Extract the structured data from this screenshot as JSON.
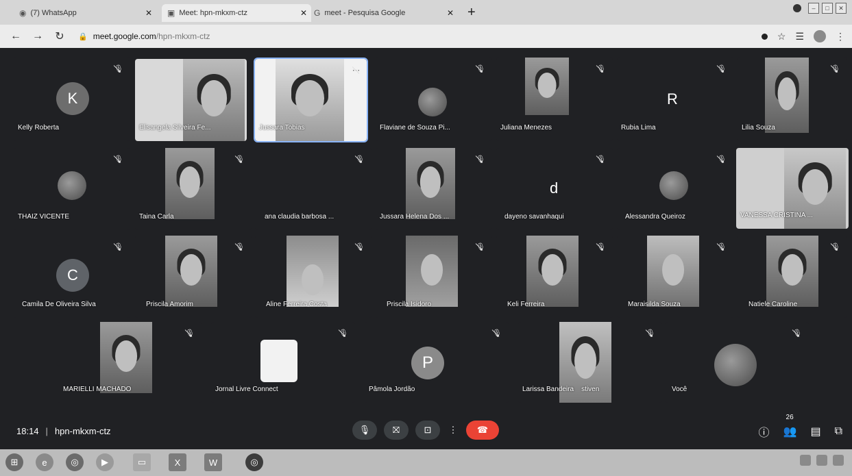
{
  "browser": {
    "tabs": [
      {
        "label": "(7) WhatsApp",
        "icon": "whatsapp-icon"
      },
      {
        "label": "Meet: hpn-mkxm-ctz",
        "icon": "meet-icon",
        "active": true
      },
      {
        "label": "meet - Pesquisa Google",
        "icon": "google-icon"
      }
    ],
    "url_host": "meet.google.com",
    "url_path": "/hpn-mkxm-ctz"
  },
  "meet": {
    "participants": [
      {
        "name": "Kelly Roberta",
        "avatar_letter": "K"
      },
      {
        "name": "Elisangela Silveira Fe...",
        "avatar_letter": ""
      },
      {
        "name": "Jussara Tobias",
        "avatar_letter": ""
      },
      {
        "name": "Flaviane de Souza Pi...",
        "avatar_letter": ""
      },
      {
        "name": "Juliana Menezes",
        "avatar_letter": ""
      },
      {
        "name": "Rubia Lima",
        "avatar_letter": "R"
      },
      {
        "name": "Lilia Souza",
        "avatar_letter": ""
      },
      {
        "name": "THAIZ VICENTE",
        "avatar_letter": ""
      },
      {
        "name": "Taina Carla",
        "avatar_letter": ""
      },
      {
        "name": "ana claudia barbosa ...",
        "avatar_letter": ""
      },
      {
        "name": "Jussara Helena Dos ...",
        "avatar_letter": ""
      },
      {
        "name": "dayeno savanhaqui",
        "avatar_letter": "d"
      },
      {
        "name": "Alessandra Queiroz",
        "avatar_letter": ""
      },
      {
        "name": "VANESSA CRISTINA ...",
        "avatar_letter": ""
      },
      {
        "name": "Camila De Oliveira Silva",
        "avatar_letter": "C"
      },
      {
        "name": "Priscila Amorim",
        "avatar_letter": ""
      },
      {
        "name": "Aline Ferreira Costa",
        "avatar_letter": ""
      },
      {
        "name": "Priscila Isidoro",
        "avatar_letter": ""
      },
      {
        "name": "Keli Ferreira",
        "avatar_letter": ""
      },
      {
        "name": "Maraisilda Souza",
        "avatar_letter": ""
      },
      {
        "name": "Natiele Caroline",
        "avatar_letter": ""
      },
      {
        "name": "MARIELLI MACHADO",
        "avatar_letter": ""
      },
      {
        "name": "Jornal Livre Connect",
        "avatar_letter": ""
      },
      {
        "name": "Pâmola Jordão",
        "avatar_letter": "P"
      },
      {
        "name": "Larissa Bandeira",
        "avatar_letter": ""
      },
      {
        "name": "stiven",
        "avatar_letter": ""
      },
      {
        "name": "Você",
        "avatar_letter": ""
      }
    ],
    "time": "18:14",
    "meeting_code": "hpn-mkxm-ctz",
    "people_count": "26"
  },
  "colors": {
    "meet_bg": "#202124",
    "avatar_k": "#6d6d6d",
    "avatar_c": "#5f6368",
    "avatar_p": "#8a8a8a",
    "hangup": "#ea4335",
    "speaking_outline": "#8ab4f8"
  }
}
